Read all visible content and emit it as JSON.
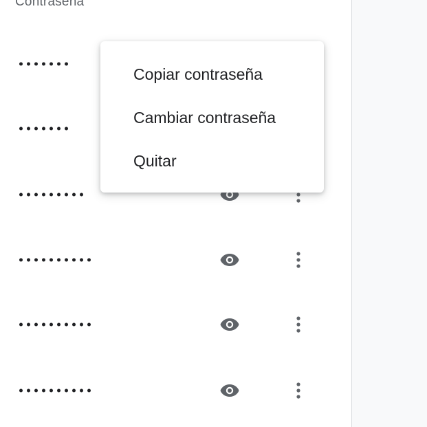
{
  "passwords": {
    "column_header": "Contraseña",
    "rows_count_visible": 6,
    "dots_per_row": [
      7,
      7,
      9,
      10,
      10,
      10
    ]
  },
  "icons": {
    "show": "eye-icon",
    "more": "more-vert-icon"
  },
  "context_menu": {
    "items": [
      {
        "label": "Copiar contraseña"
      },
      {
        "label": "Cambiar contraseña"
      },
      {
        "label": "Quitar"
      }
    ]
  },
  "colors": {
    "icon": "#5f6368",
    "text": "#202124",
    "muted": "#5f6368",
    "divider": "#dadce0"
  }
}
